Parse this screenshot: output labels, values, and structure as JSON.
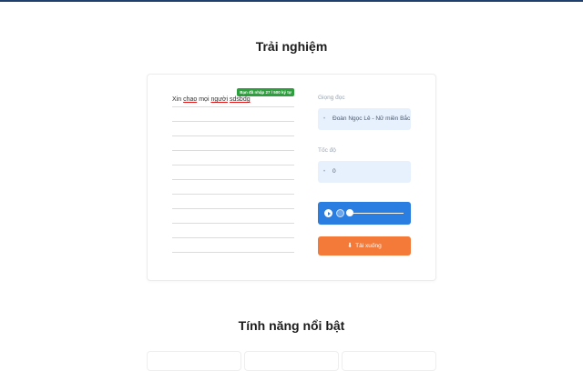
{
  "sections": {
    "try_title": "Trải nghiệm",
    "features_title": "Tính năng nổi bật"
  },
  "editor": {
    "counter": "Bạn đã nhập 27 / 500 ký tự",
    "text_words": [
      "Xin",
      "chao",
      "mọi",
      "người",
      "sdsbdg"
    ],
    "misspelled_words": [
      "chao",
      "người",
      "sdsbdg"
    ]
  },
  "voice": {
    "label": "Giọng đọc",
    "value": "Đoàn Ngọc Lê - Nữ miền Bắc"
  },
  "speed": {
    "label": "Tốc độ",
    "value": "0"
  },
  "download": {
    "label": "Tải xuống"
  },
  "colors": {
    "accent_blue": "#2a7de1",
    "download_orange": "#f47a3a",
    "counter_green": "#2e9e3e"
  }
}
